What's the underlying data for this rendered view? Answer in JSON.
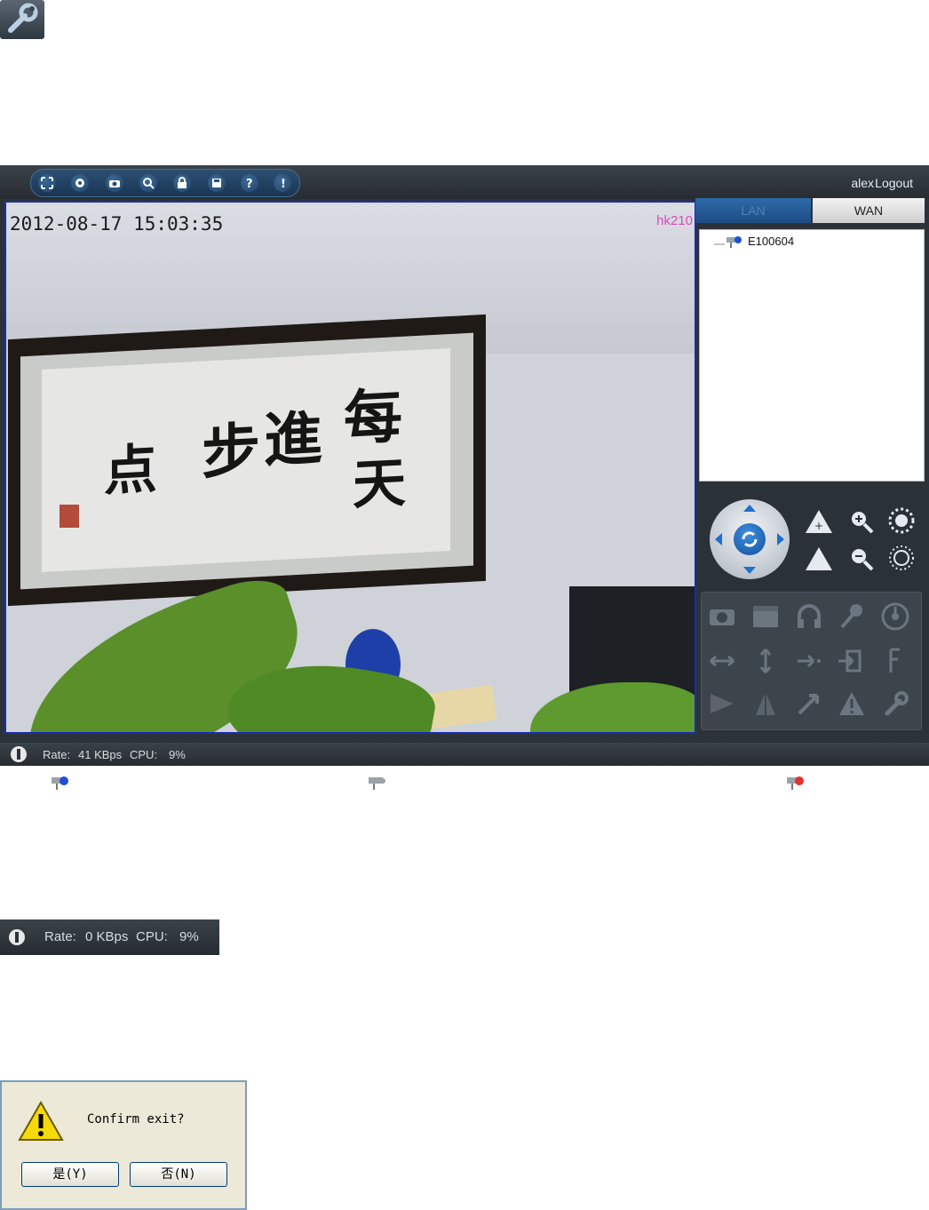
{
  "app": {
    "user": "alex",
    "logout_label": "Logout"
  },
  "toolbar": {
    "icons": [
      "fullscreen-icon",
      "record-icon",
      "snapshot-icon",
      "search-icon",
      "lock-icon",
      "save-icon",
      "help-icon",
      "about-icon"
    ]
  },
  "video": {
    "timestamp": "2012-08-17 15:03:35",
    "camera_name": "hk210"
  },
  "device_panel": {
    "tabs": [
      {
        "label": "LAN"
      },
      {
        "label": "WAN"
      }
    ],
    "active_tab": "WAN",
    "devices": [
      {
        "name": "E100604",
        "status": "online"
      }
    ]
  },
  "ptz": {
    "icons": [
      "pan-tilt-joystick",
      "focus-near-icon",
      "zoom-in-icon",
      "brightness-up-icon",
      "focus-far-icon",
      "zoom-out-icon",
      "brightness-down-icon"
    ]
  },
  "functions": {
    "icons": [
      "camera-snapshot-icon",
      "video-record-icon",
      "headphones-icon",
      "microphone-icon",
      "cruise-icon",
      "horizontal-scan-icon",
      "vertical-scan-icon",
      "preset-icon",
      "goto-preset-icon",
      "flip-icon",
      "mirror-icon",
      "triangle-icon",
      "arrow-diagonal-icon",
      "warning-icon",
      "wrench-icon"
    ]
  },
  "status_bar": {
    "rate_label": "Rate:",
    "rate_value": "41 KBps",
    "cpu_label": "CPU:",
    "cpu_value": "9%"
  },
  "status_bar_idle": {
    "rate_label": "Rate:",
    "rate_value": "0 KBps",
    "cpu_label": "CPU:",
    "cpu_value": "9%"
  },
  "legend": {
    "online_color": "#1f4fd8",
    "offline_color": "#9aa3aa",
    "alarm_color": "#e0332a"
  },
  "dialog": {
    "message": "Confirm exit?",
    "yes_label": "是(Y)",
    "no_label": "否(N)"
  }
}
